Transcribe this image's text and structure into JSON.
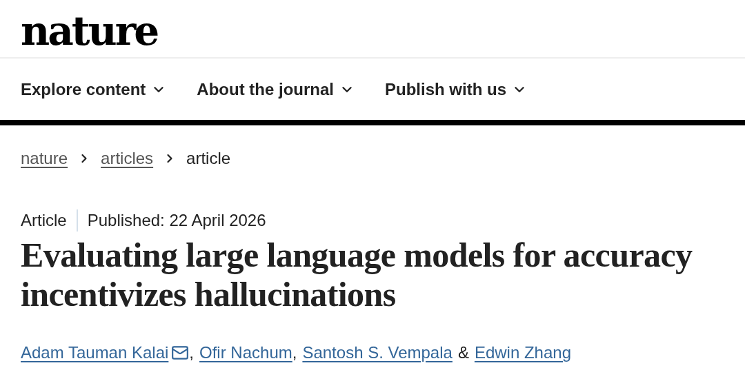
{
  "logo": "nature",
  "nav": [
    {
      "label": "Explore content",
      "expanded": false
    },
    {
      "label": "About the journal",
      "expanded": false
    },
    {
      "label": "Publish with us",
      "expanded": false
    }
  ],
  "breadcrumb": [
    {
      "label": "nature",
      "kind": "link"
    },
    {
      "label": "articles",
      "kind": "link"
    },
    {
      "label": "article",
      "kind": "current"
    }
  ],
  "article": {
    "type": "Article",
    "published": "Published: 22 April 2026",
    "title": "Evaluating large language models for accuracy incentivizes hallucinations",
    "authors": [
      {
        "name": "Adam Tauman Kalai",
        "corresponding": true,
        "separator": ","
      },
      {
        "name": "Ofir Nachum",
        "corresponding": false,
        "separator": ","
      },
      {
        "name": "Santosh S. Vempala",
        "corresponding": false,
        "separator": "&"
      },
      {
        "name": "Edwin Zhang",
        "corresponding": false
      }
    ]
  }
}
